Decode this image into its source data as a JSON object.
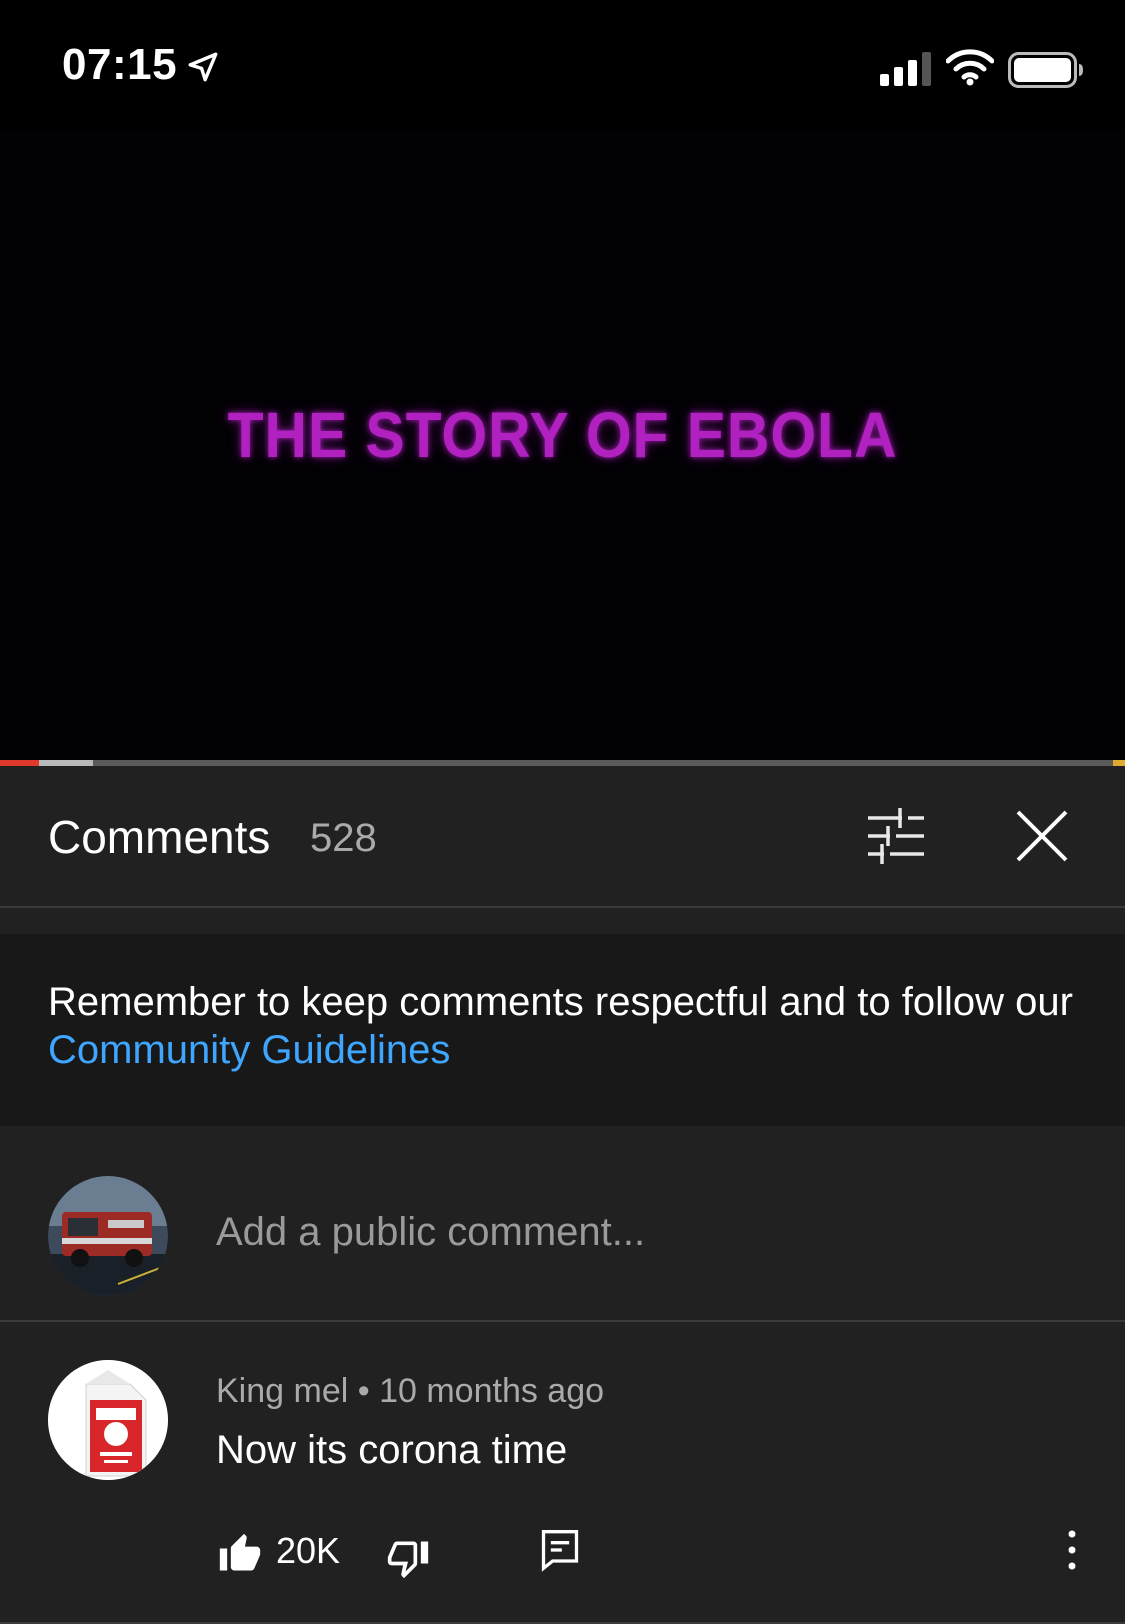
{
  "status_bar": {
    "time": "07:15"
  },
  "video": {
    "title_text": "THE STORY OF EBOLA",
    "title_color": "#b021c0",
    "progress_played_fraction": 0.035,
    "progress_buffered_fraction": 0.083
  },
  "comments_panel": {
    "title": "Comments",
    "count": "528",
    "guidelines": {
      "text": "Remember to keep comments respectful and to follow our",
      "link_text": "Community Guidelines",
      "link_color": "#3ea6ff"
    },
    "add_comment": {
      "placeholder": "Add a public comment..."
    },
    "comments": [
      {
        "author": "King mel",
        "separator": "•",
        "time_ago": "10 months ago",
        "text": "Now its corona time",
        "likes": "20K"
      }
    ]
  },
  "icons": {
    "location": "location-arrow-icon",
    "signal": "cellular-signal-icon",
    "wifi": "wifi-icon",
    "battery": "battery-icon",
    "sort": "sort-filter-icon",
    "close": "close-icon",
    "like": "thumbs-up-icon",
    "dislike": "thumbs-down-icon",
    "reply": "reply-icon",
    "more": "more-vert-icon"
  }
}
